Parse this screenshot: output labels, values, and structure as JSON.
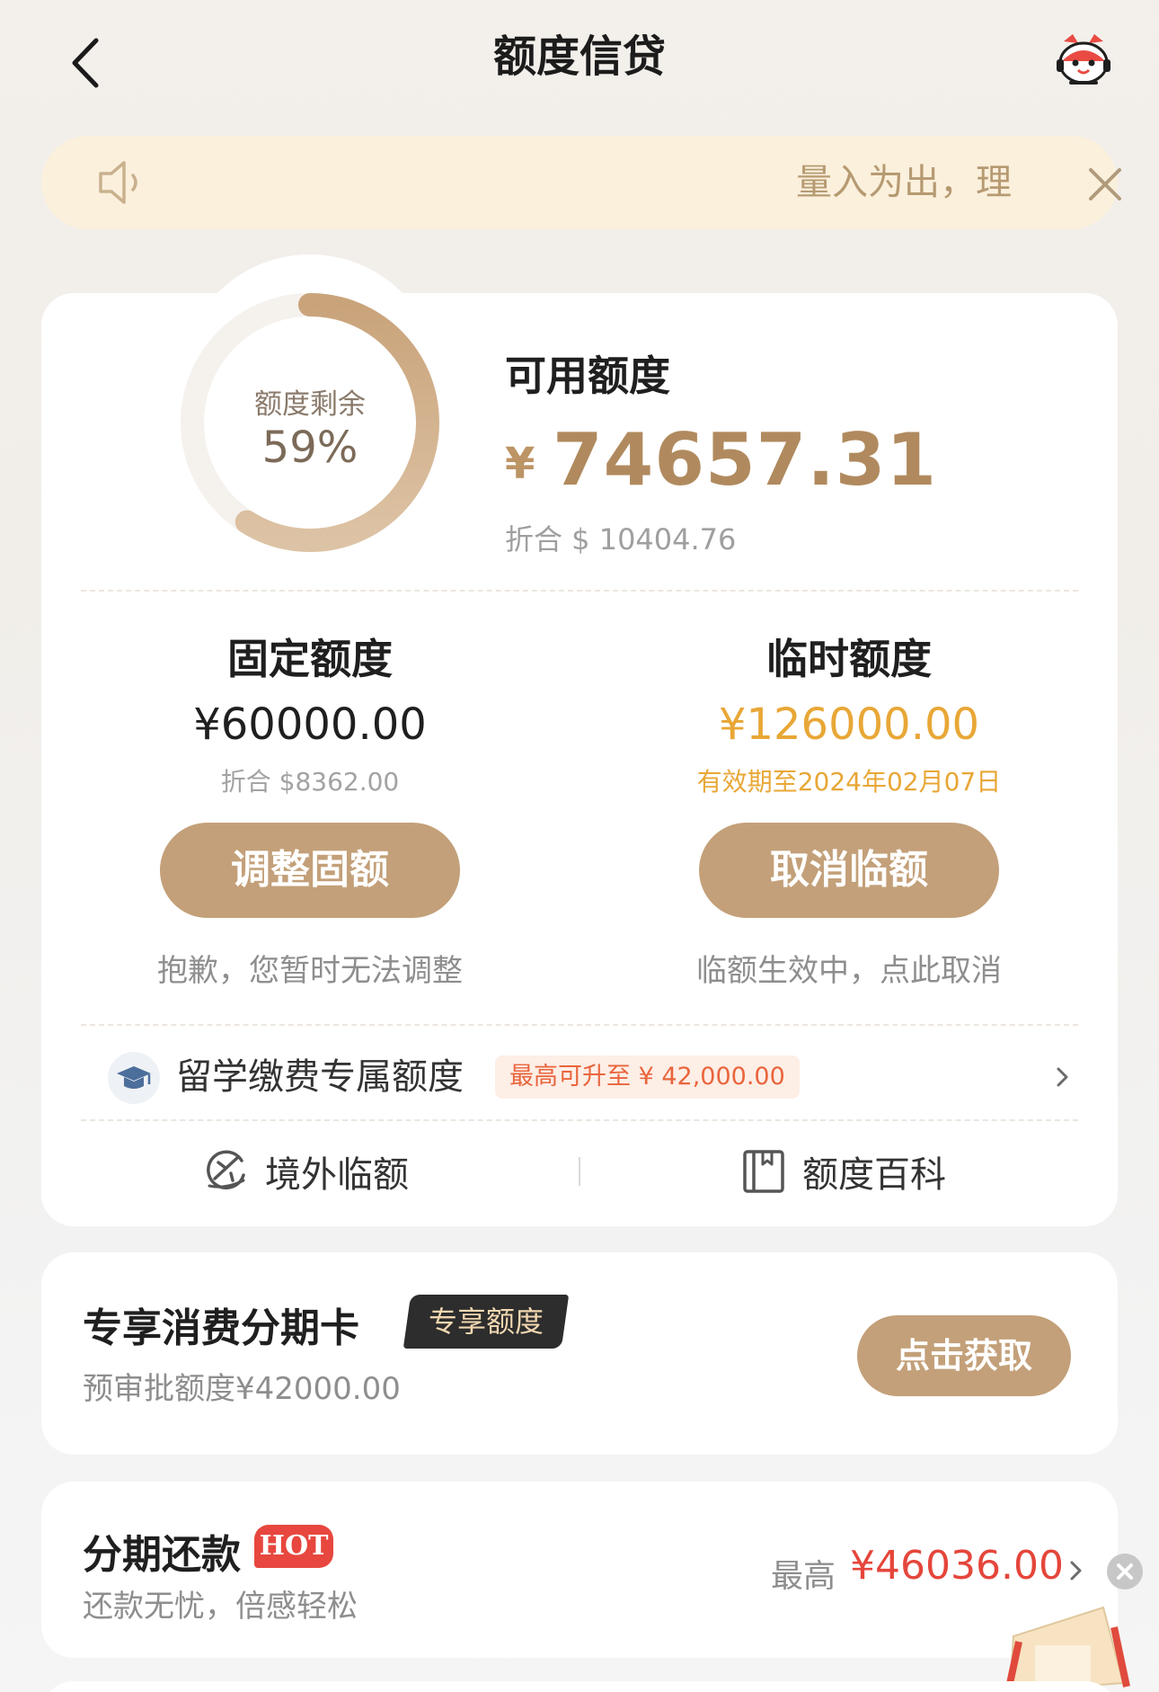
{
  "header": {
    "title": "额度信贷"
  },
  "notice": {
    "text": "量入为出，理"
  },
  "credit": {
    "ring_label": "额度剩余",
    "ring_percent": "59%",
    "ring_fraction": 0.59,
    "available_title": "可用额度",
    "currency_symbol": "¥",
    "available_amount": "74657.31",
    "available_converted": "折合 $ 10404.76"
  },
  "fixed": {
    "title": "固定额度",
    "amount": "¥60000.00",
    "converted": "折合 $8362.00",
    "button": "调整固额",
    "note": "抱歉，您暂时无法调整"
  },
  "temporary": {
    "title": "临时额度",
    "amount": "¥126000.00",
    "validity": "有效期至2024年02月07日",
    "button": "取消临额",
    "note": "临额生效中，点此取消"
  },
  "study": {
    "label": "留学缴费专属额度",
    "badge": "最高可升至 ¥ 42,000.00"
  },
  "tools": {
    "overseas": "境外临额",
    "wiki": "额度百科"
  },
  "card_installment": {
    "title": "专享消费分期卡",
    "tag": "专享额度",
    "subtitle": "预审批额度¥42000.00",
    "button": "点击获取"
  },
  "repay": {
    "title": "分期还款",
    "hot": "HOT",
    "subtitle": "还款无忧，倍感轻松",
    "max_label": "最高",
    "max_amount": "¥46036.00"
  },
  "colors": {
    "accent": "#c3a079",
    "gold_text": "#b08a5e",
    "temp_amount": "#e8a736",
    "red": "#e5463b"
  }
}
